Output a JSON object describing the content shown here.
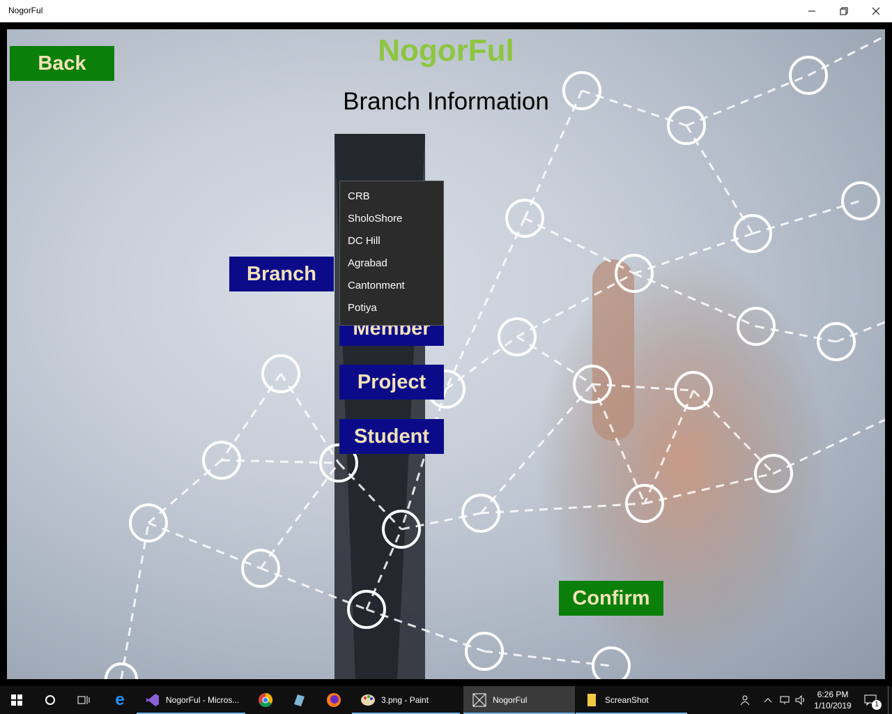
{
  "window": {
    "title": "NogorFul"
  },
  "app": {
    "title": "NogorFul",
    "page_title": "Branch Information",
    "buttons": {
      "back": "Back",
      "branch": "Branch",
      "member": "Member",
      "project": "Project",
      "student": "Student",
      "confirm": "Confirm"
    },
    "branch_options": [
      "CRB",
      "SholoShore",
      "DC Hill",
      "Agrabad",
      "Cantonment",
      "Potiya"
    ]
  },
  "taskbar": {
    "apps": [
      {
        "label": "NogorFul - Micros..."
      },
      {
        "label": "3.png - Paint"
      },
      {
        "label": "NogorFul"
      },
      {
        "label": "ScreanShot"
      }
    ],
    "clock": {
      "time": "6:26 PM",
      "date": "1/10/2019"
    },
    "notification_count": "1"
  },
  "colors": {
    "title_green": "#8dc63f",
    "button_green": "#0a7f0a",
    "button_navy": "#0b0b8a",
    "button_text": "#f2e2b8",
    "dropdown_bg": "#2b2b2b"
  }
}
